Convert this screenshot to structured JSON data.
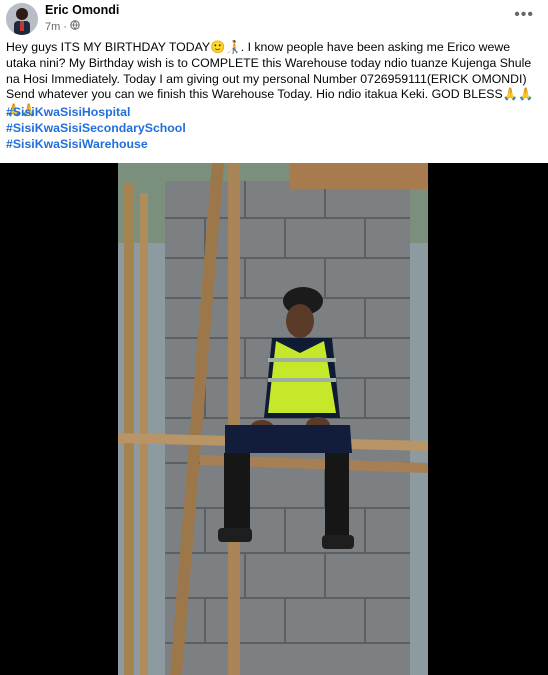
{
  "post": {
    "author": "Eric Omondi",
    "time": "7m",
    "separator": "·",
    "visibility_icon": "globe-icon",
    "more_icon": "more-options-icon",
    "more_label": "•••",
    "text_parts": [
      "Hey guys ITS MY BIRTHDAY TODAY",
      "🙂",
      "🧑‍🦯",
      ". I know people have been asking me Erico wewe utaka nini? My Birthday wish is to COMPLETE this Warehouse today ndio tuanze Kujenga Shule na Hosi Immediately. Today I am giving out my personal Number 0726959111(ERICK OMONDI) Send whatever you can we finish this Warehouse Today. Hio ndio itakua Keki. GOD BLESS",
      "🙏🙏🙏🙏"
    ],
    "hashtags": [
      "#SisiKwaSisiHospital",
      "#SisiKwaSisiSecondarySchool",
      "#SisiKwaSisiWarehouse"
    ]
  },
  "colors": {
    "link": "#216fdb",
    "secondary_text": "#65676b",
    "video_bg": "#000000"
  }
}
